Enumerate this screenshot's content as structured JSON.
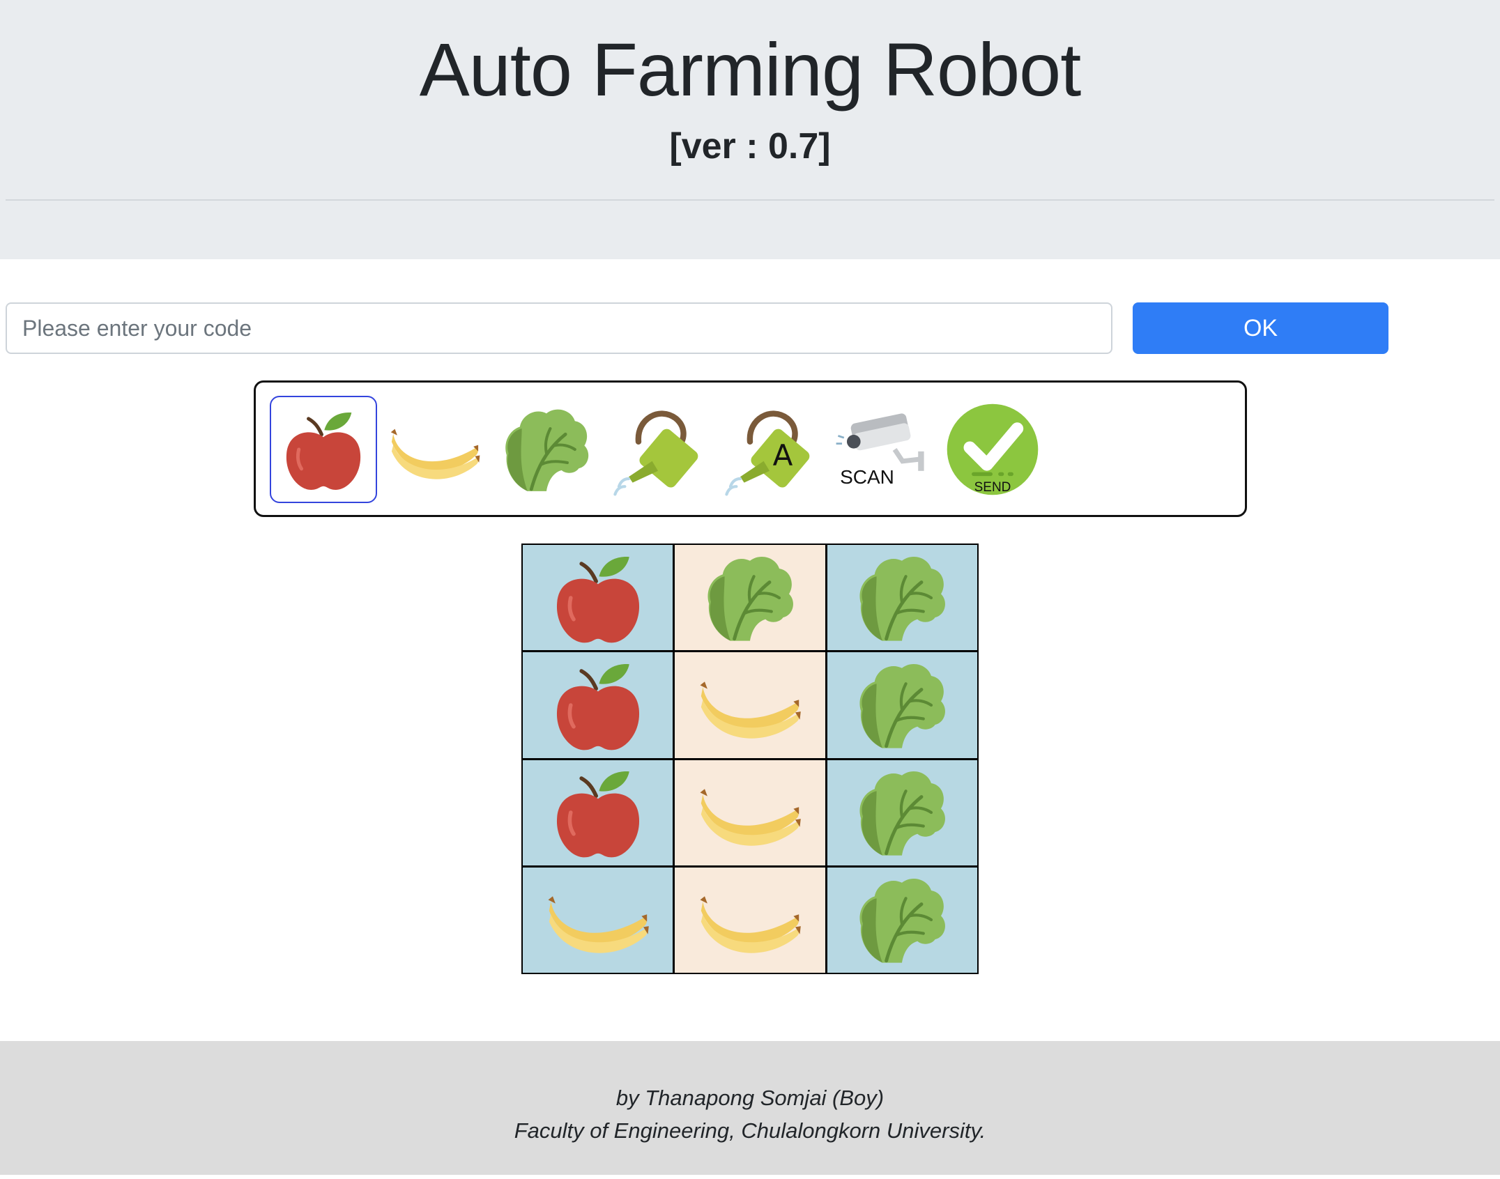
{
  "header": {
    "title": "Auto Farming Robot",
    "version": "[ver : 0.7]"
  },
  "code_entry": {
    "placeholder": "Please enter your code",
    "value": "",
    "ok_label": "OK"
  },
  "toolbar": {
    "selected_tool": "apple",
    "tools": [
      {
        "icon": "apple-icon",
        "label": ""
      },
      {
        "icon": "banana-icon",
        "label": ""
      },
      {
        "icon": "lettuce-icon",
        "label": ""
      },
      {
        "icon": "watering-can-icon",
        "label": ""
      },
      {
        "icon": "auto-watering-can-icon",
        "label": "A"
      },
      {
        "icon": "scan-camera-icon",
        "label": "SCAN"
      },
      {
        "icon": "send-check-icon",
        "label": "SEND"
      }
    ]
  },
  "farm_grid": {
    "rows": 4,
    "cols": 3,
    "cells": [
      [
        "apple",
        "lettuce",
        "lettuce"
      ],
      [
        "apple",
        "banana",
        "lettuce"
      ],
      [
        "apple",
        "banana",
        "lettuce"
      ],
      [
        "banana",
        "banana",
        "lettuce"
      ]
    ]
  },
  "footer": {
    "line1": "by Thanapong Somjai (Boy)",
    "line2": "Faculty of Engineering, Chulalongkorn University."
  },
  "colors": {
    "header_bg": "#e9ecef",
    "ok_button": "#2f7df6",
    "grid_blue": "#b7d8e3",
    "grid_cream": "#f9eadb",
    "footer_bg": "#dcdcdc"
  }
}
